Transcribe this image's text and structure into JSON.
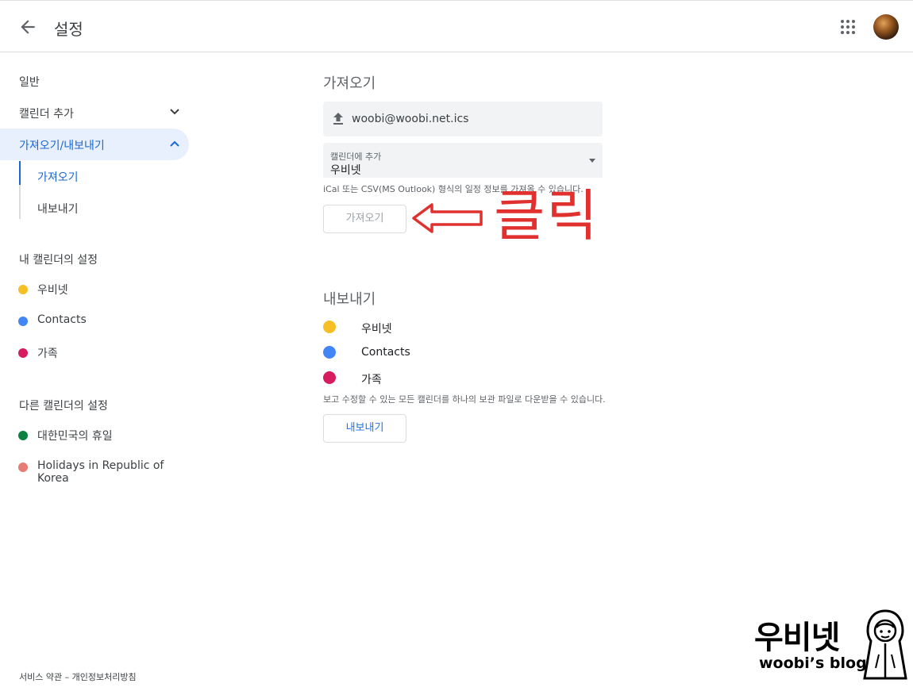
{
  "header": {
    "title": "설정"
  },
  "sidebar": {
    "general": "일반",
    "add_calendar": "캘린더 추가",
    "import_export": "가져오기/내보내기",
    "import": "가져오기",
    "export": "내보내기",
    "my_calendars_heading": "내 캘린더의 설정",
    "my_calendars": [
      {
        "name": "우비넷",
        "color": "#f6bf26"
      },
      {
        "name": "Contacts",
        "color": "#4285f4"
      },
      {
        "name": "가족",
        "color": "#d81b60"
      }
    ],
    "other_calendars_heading": "다른 캘린더의 설정",
    "other_calendars": [
      {
        "name": "대한민국의 휴일",
        "color": "#0b8043"
      },
      {
        "name": "Holidays in Republic of Korea",
        "color": "#e67c73"
      }
    ],
    "footer": {
      "terms": "서비스 약관",
      "separator": "–",
      "privacy": "개인정보처리방침"
    }
  },
  "import": {
    "title": "가져오기",
    "file_name": "woobi@woobi.net.ics",
    "select_caption": "캘린더에 추가",
    "select_value": "우비넷",
    "hint": "iCal 또는 CSV(MS Outlook) 형식의 일정 정보를 가져올 수 있습니다.",
    "button": "가져오기"
  },
  "export": {
    "title": "내보내기",
    "calendars": [
      {
        "name": "우비넷",
        "color": "#f6bf26"
      },
      {
        "name": "Contacts",
        "color": "#4285f4"
      },
      {
        "name": "가족",
        "color": "#d81b60"
      }
    ],
    "hint": "보고 수정할 수 있는 모든 캘린더를 하나의 보관 파일로 다운받을 수 있습니다.",
    "button": "내보내기"
  },
  "annotation": {
    "text": "클릭",
    "color": "#e0312f"
  },
  "watermark": {
    "title": "우비넷",
    "subtitle": "woobi’s blog"
  },
  "icons": [
    "back-arrow-icon",
    "apps-grid-icon",
    "chevron-down-icon",
    "chevron-up-icon",
    "upload-icon",
    "dropdown-caret-icon"
  ]
}
